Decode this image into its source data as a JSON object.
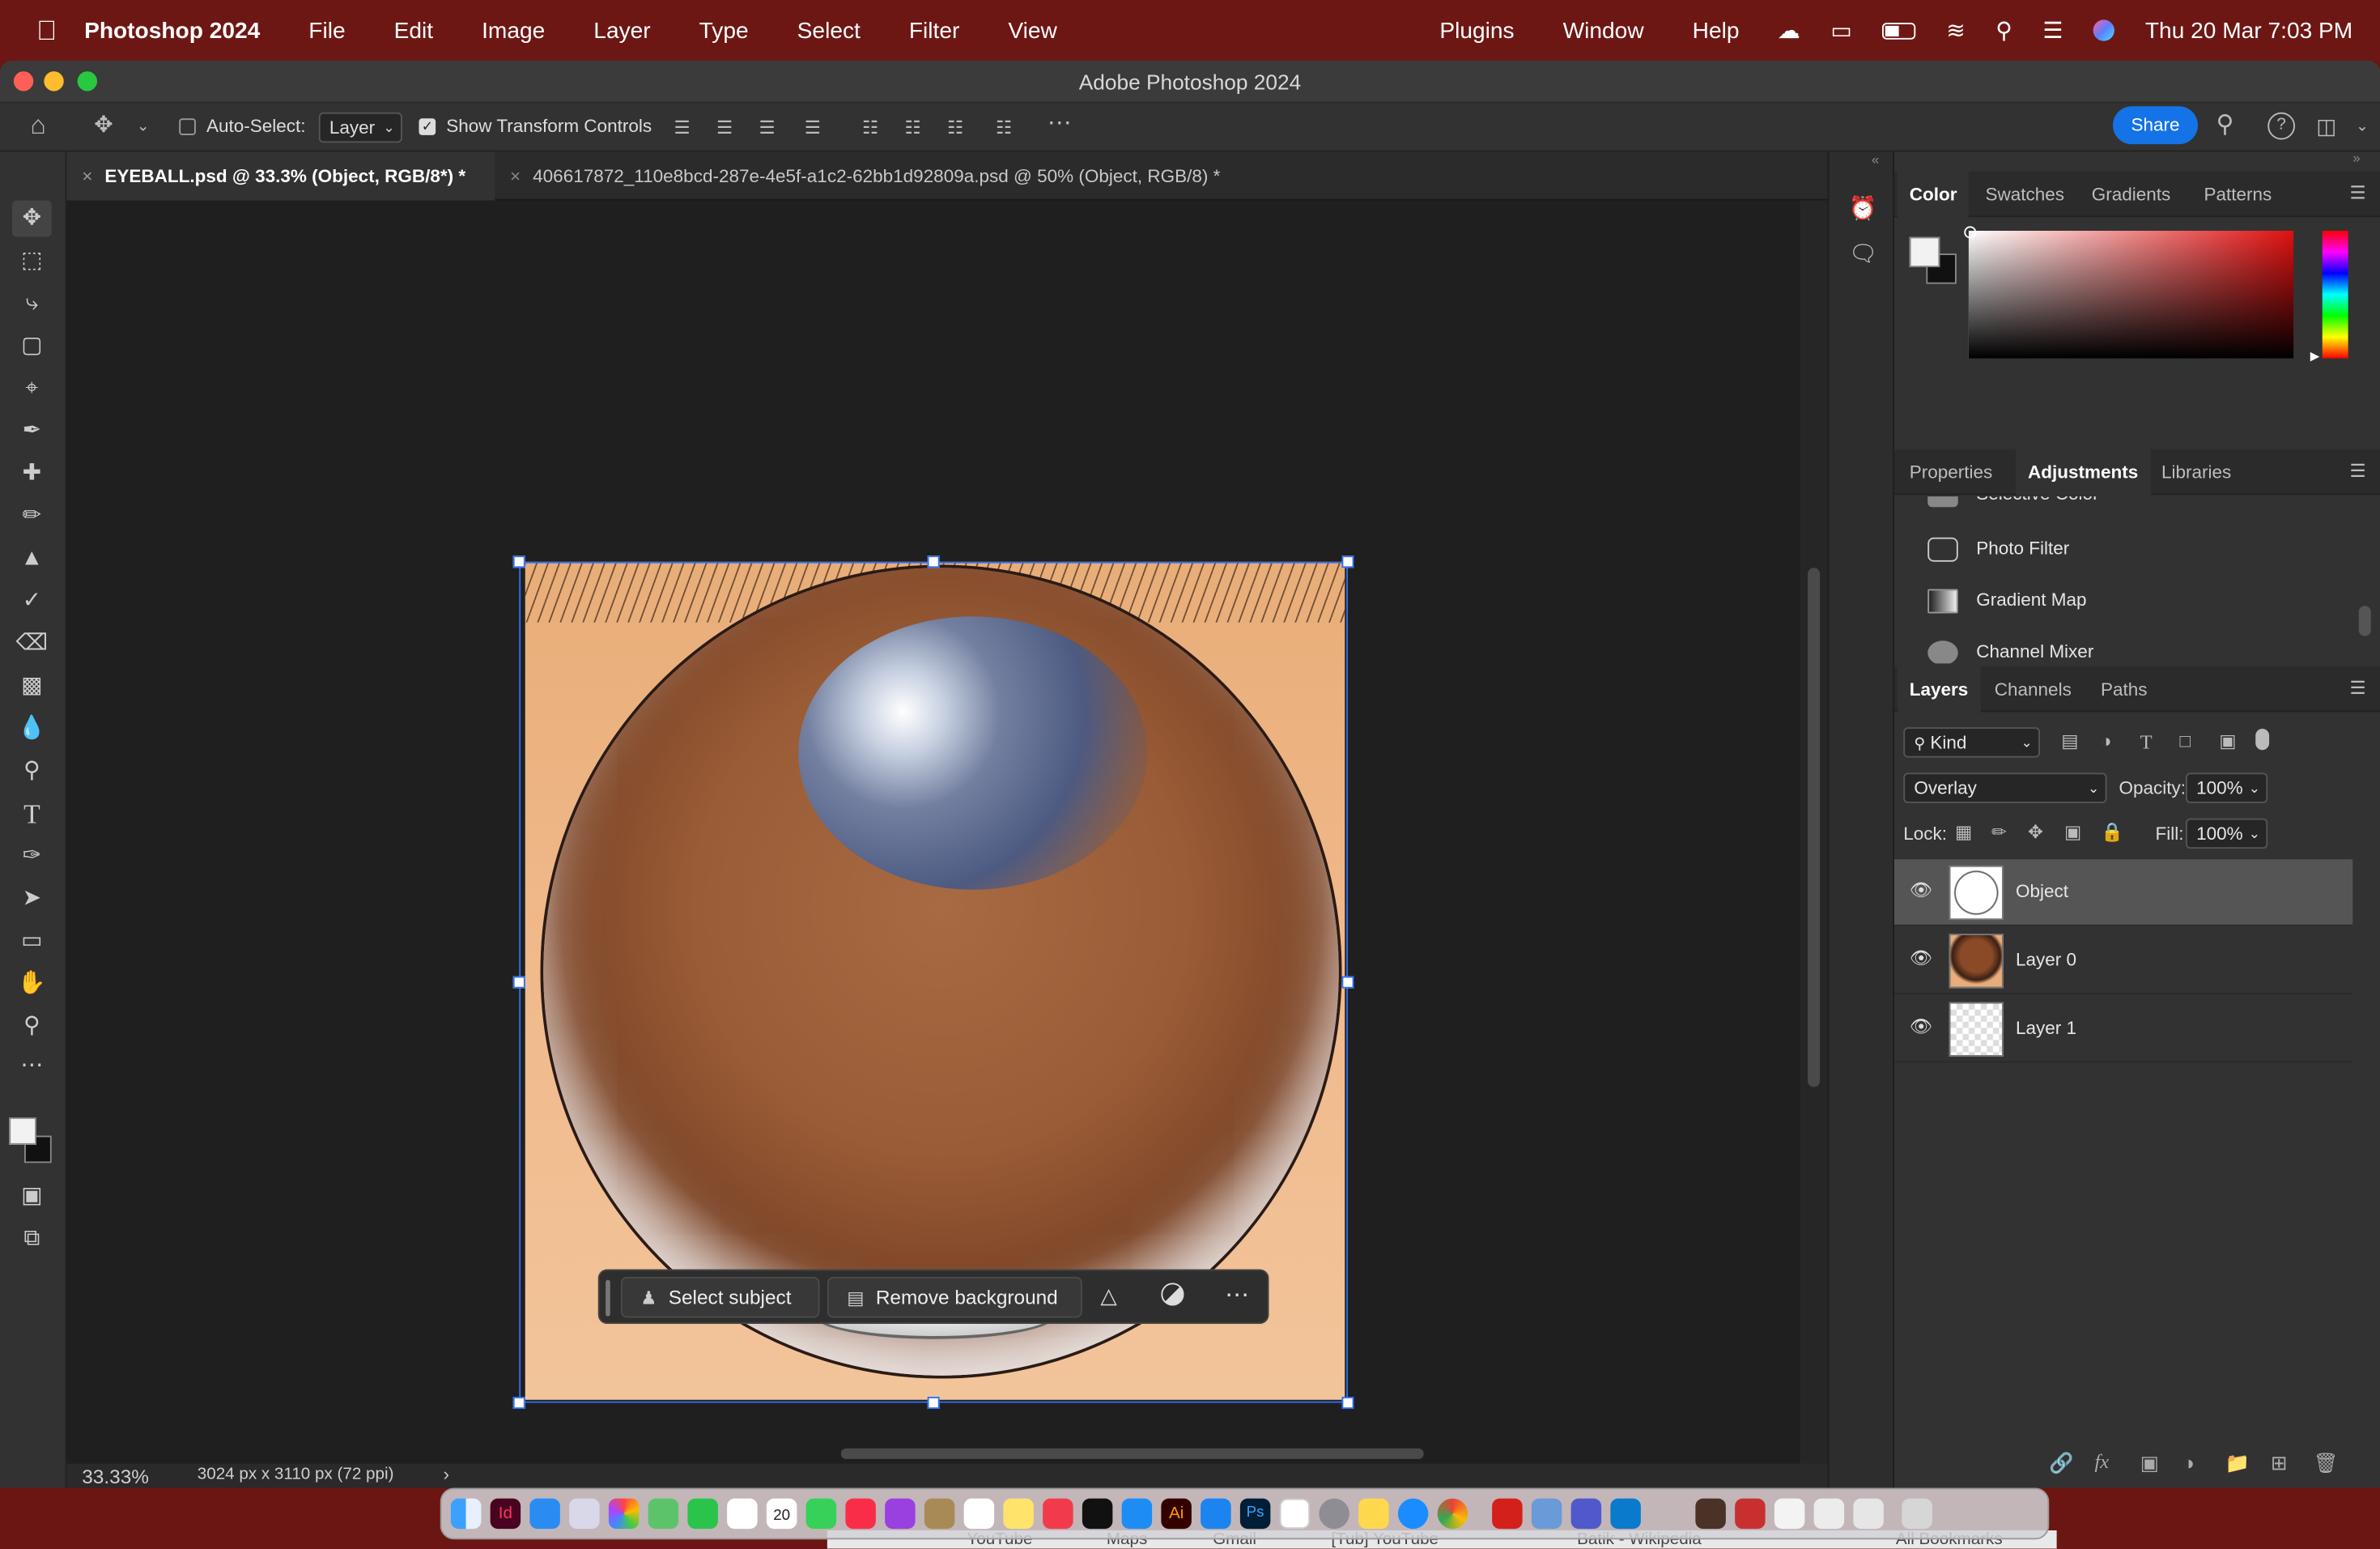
{
  "menubar": {
    "app_name": "Photoshop 2024",
    "menus": [
      "File",
      "Edit",
      "Image",
      "Layer",
      "Type",
      "Select",
      "Filter",
      "View",
      "Plugins",
      "Window",
      "Help"
    ],
    "datetime": "Thu 20 Mar  7:03 PM"
  },
  "window": {
    "title": "Adobe Photoshop 2024"
  },
  "options": {
    "auto_select_label": "Auto-Select:",
    "auto_select_value": "Layer",
    "show_transform_label": "Show Transform Controls",
    "share_label": "Share"
  },
  "tabs": [
    {
      "label": "EYEBALL.psd @ 33.3% (Object, RGB/8*) *",
      "active": true
    },
    {
      "label": "406617872_110e8bcd-287e-4e5f-a1c2-62bb1d92809a.psd @ 50% (Object, RGB/8) *",
      "active": false
    }
  ],
  "status": {
    "zoom": "33.33%",
    "dimensions": "3024 px x 3110 px (72 ppi)"
  },
  "contextbar": {
    "select_subject": "Select subject",
    "remove_background": "Remove background"
  },
  "color_panel": {
    "tabs": [
      "Color",
      "Swatches",
      "Gradients",
      "Patterns"
    ]
  },
  "adjustments_panel": {
    "tabs": [
      "Properties",
      "Adjustments",
      "Libraries"
    ],
    "items": [
      "Selective Color",
      "Photo Filter",
      "Gradient Map",
      "Channel Mixer"
    ]
  },
  "layers_panel": {
    "tabs": [
      "Layers",
      "Channels",
      "Paths"
    ],
    "filter_kind": "Kind",
    "blend_mode": "Overlay",
    "opacity_label": "Opacity:",
    "opacity_value": "100%",
    "lock_label": "Lock:",
    "fill_label": "Fill:",
    "fill_value": "100%",
    "layers": [
      {
        "name": "Object",
        "selected": true
      },
      {
        "name": "Layer 0",
        "selected": false
      },
      {
        "name": "Layer 1",
        "selected": false
      }
    ]
  },
  "browser_strip": {
    "items": [
      "YouTube",
      "Maps",
      "Gmail",
      "[Tub] YouTube",
      "Batik - Wikipedia",
      "All Bookmarks"
    ]
  },
  "colors": {
    "menubar_bg": "#6d1714",
    "share_button": "#1473e6",
    "selection_blue": "#2f6ff0"
  }
}
